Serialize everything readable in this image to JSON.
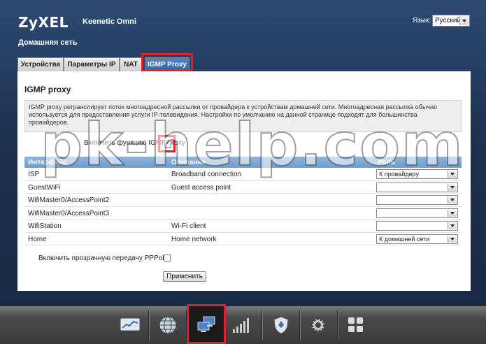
{
  "header": {
    "brand": "ZyXEL",
    "model": "Keenetic Omni",
    "lang_label": "Язык:",
    "lang_value": "Русский",
    "section_title": "Домашняя сеть"
  },
  "tabs": [
    {
      "label": "Устройства"
    },
    {
      "label": "Параметры IP"
    },
    {
      "label": "NAT"
    },
    {
      "label": "IGMP Proxy",
      "active": true
    }
  ],
  "panel": {
    "title": "IGMP proxy",
    "info": "IGMP proxy ретранслирует поток многоадресной рассылки от провайдера к устройствам домашней сети. Многоадресная рассылка обычно используется для предоставления услуги IP-телевидения. Настройки по умолчанию на данной странице подходят для большинства провайдеров.",
    "enable_label": "Включить функцию IGMP proxy",
    "enable_checked": true
  },
  "table": {
    "headers": {
      "interface": "Интерфейс",
      "description": "Описание",
      "role": "Роль"
    },
    "rows": [
      {
        "interface": "ISP",
        "description": "Broadband connection",
        "role": "К провайдеру"
      },
      {
        "interface": "GuestWiFi",
        "description": "Guest access point",
        "role": ""
      },
      {
        "interface": "WifiMaster0/AccessPoint2",
        "description": "",
        "role": ""
      },
      {
        "interface": "WifiMaster0/AccessPoint3",
        "description": "",
        "role": ""
      },
      {
        "interface": "WifiStation",
        "description": "Wi-Fi client",
        "role": ""
      },
      {
        "interface": "Home",
        "description": "Home network",
        "role": "К домашней сети"
      }
    ]
  },
  "pppoe_label": "Включить прозрачную передачу PPPoE:",
  "pppoe_checked": false,
  "apply_label": "Применить",
  "watermark": "pk-help.com",
  "dock": [
    "monitor-icon",
    "internet-globe-icon",
    "home-network-icon",
    "wifi-signal-icon",
    "security-shield-icon",
    "system-gear-icon",
    "apps-grid-icon"
  ],
  "colors": {
    "highlight": "#e0202a",
    "tab_active": "#3a72b5",
    "grid_header": "#7fa8d6"
  }
}
